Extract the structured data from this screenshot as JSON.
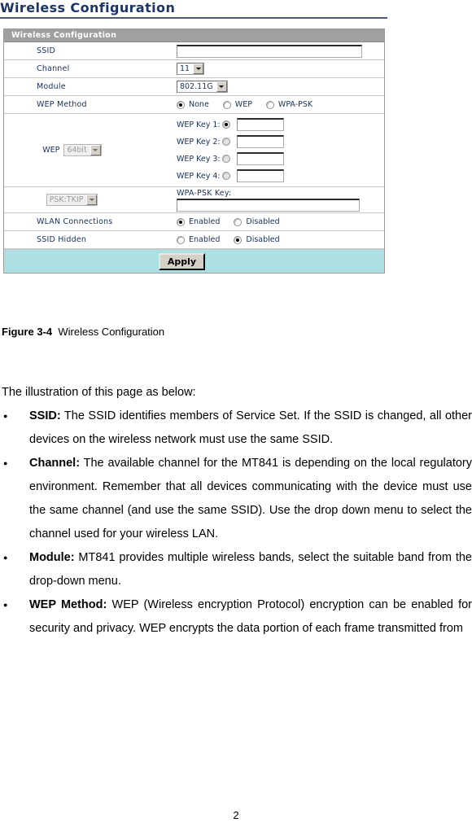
{
  "heading": "Wireless Configuration",
  "panel": {
    "title": "Wireless Configuration",
    "rows": {
      "ssid": {
        "label": "SSID",
        "value": "",
        "placeholder": ""
      },
      "channel": {
        "label": "Channel",
        "value": "11"
      },
      "module": {
        "label": "Module",
        "value": "802.11G"
      },
      "wep_method": {
        "label": "WEP Method",
        "options": [
          "None",
          "WEP",
          "WPA-PSK"
        ],
        "selected": "None"
      },
      "wep": {
        "label": "WEP",
        "strength_value": "64bit",
        "strength_disabled": true,
        "keys": [
          {
            "label": "WEP Key 1:",
            "value": "",
            "selected": true
          },
          {
            "label": "WEP Key 2:",
            "value": "",
            "selected": false
          },
          {
            "label": "WEP Key 3:",
            "value": "",
            "selected": false
          },
          {
            "label": "WEP Key 4:",
            "value": "",
            "selected": false
          }
        ]
      },
      "wpa": {
        "cipher_value": "PSK:TKIP",
        "cipher_disabled": true,
        "key_label": "WPA-PSK Key:",
        "key_value": ""
      },
      "wlan_connections": {
        "label": "WLAN Connections",
        "options": [
          "Enabled",
          "Disabled"
        ],
        "selected": "Enabled"
      },
      "ssid_hidden": {
        "label": "SSID Hidden",
        "options": [
          "Enabled",
          "Disabled"
        ],
        "selected": "Disabled"
      }
    },
    "apply_label": "Apply"
  },
  "figure": {
    "number": "Figure 3-4",
    "caption": "Wireless Configuration"
  },
  "body": {
    "intro": "The illustration of this page as below:",
    "bullets": [
      {
        "term": "SSID:",
        "text": " The SSID identifies members of Service Set. If the SSID is changed, all other devices on the wireless network must use the same SSID."
      },
      {
        "term": "Channel:",
        "text": " The available channel for the MT841 is depending on the local regulatory environment. Remember that all devices communicating with the device must use the same channel (and use the same SSID). Use the drop down menu to select the channel used for your wireless LAN."
      },
      {
        "term": "Module:",
        "text": " MT841 provides multiple wireless bands, select the suitable band from the drop-down menu."
      },
      {
        "term": "WEP Method:",
        "text": " WEP (Wireless encryption Protocol) encryption can be enabled for security and privacy. WEP encrypts the data portion of each frame transmitted from"
      }
    ]
  },
  "page_number": "2",
  "colors": {
    "heading_navy": "#1b3566",
    "panel_header_gray": "#a0a0a0",
    "apply_row_teal": "#ade0e4",
    "label_navy": "#17305c"
  }
}
